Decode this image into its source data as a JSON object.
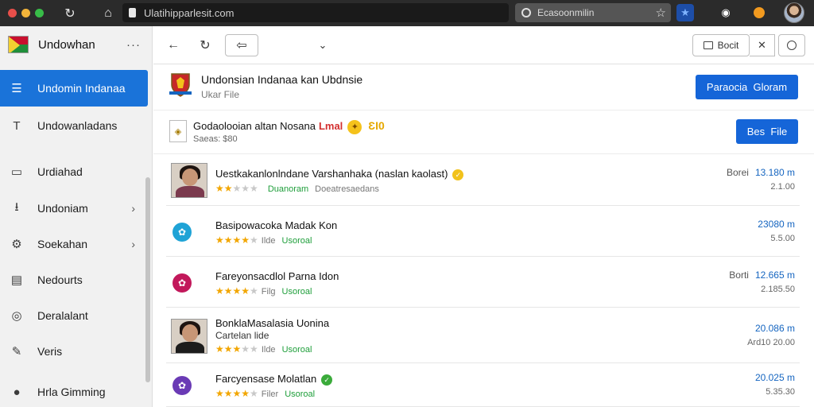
{
  "browser": {
    "url": "Ulatihipparlesit.com",
    "search": "Ecasoonmilin",
    "traffic_lights": [
      "#e84f4a",
      "#f3b43a",
      "#38bc48"
    ],
    "extensions": [
      {
        "icon": "star-outline-icon",
        "color": "#dddddd"
      },
      {
        "icon": "star-extension-icon",
        "color": "#1a73e8"
      },
      {
        "icon": "camera-extension-icon",
        "color": "#333333"
      },
      {
        "icon": "orange-extension-icon",
        "color": "#f29a1f"
      }
    ]
  },
  "sidebar": {
    "title": "Undowhan",
    "more": "···",
    "items": [
      {
        "label": "Undomin Indanaa",
        "icon": "list-icon",
        "active": true
      },
      {
        "label": "Undowanladans",
        "icon": "text-icon"
      },
      {
        "label": "Urdiahad",
        "icon": "drive-icon"
      },
      {
        "label": "Undoniam",
        "icon": "upload-icon",
        "chevron": true
      },
      {
        "label": "Soekahan",
        "icon": "gear-icon",
        "chevron": true
      },
      {
        "label": "Nedourts",
        "icon": "document-icon"
      },
      {
        "label": "Deralalant",
        "icon": "circle-icon"
      },
      {
        "label": "Veris",
        "icon": "pen-icon"
      },
      {
        "label": "Hrla Gimming",
        "icon": "chat-icon"
      }
    ]
  },
  "toolbar": {
    "back": "←",
    "reload": "↻",
    "forward": "⇦",
    "dropdown": "⌄",
    "action_label": "Bocit",
    "close": "✕",
    "search": "🔍"
  },
  "header": {
    "title": "Undonsian Indanaa kan Ubdnsie",
    "subtitle": "Ukar File",
    "button": "Paraocia  Gloram"
  },
  "featured": {
    "title": "Godaolooian altan Nosana",
    "tag": "Lmal",
    "badge": "ƐI0",
    "subtitle": "Saeas: $80",
    "button": "Bes  File"
  },
  "rows": [
    {
      "title": "Uestkakanlonlndane Varshanhaka (naslan kaolast)",
      "rating": 2,
      "meta_grey": "",
      "meta_green": "Duanoram",
      "meta_extra": "Doeatresaedans",
      "prefix": "Borei",
      "price": "13.180 m",
      "sub": "2.1.00",
      "kind": "photo",
      "body_color": "#7b3a4e",
      "check_color": "#f2c21b"
    },
    {
      "title": "Basipowacoka Madak Kon",
      "rating": 4,
      "meta_grey": "Ilde",
      "meta_green": "Usoroal",
      "prefix": "",
      "price": "23080 m",
      "sub": "5.5.00",
      "kind": "icon",
      "icon_color": "#1fa3d6"
    },
    {
      "title": "Fareyonsacdlol Parna Idon",
      "rating": 4,
      "meta_grey": "Filg",
      "meta_green": "Usoroal",
      "prefix": "Borti",
      "price": "12.665 m",
      "sub": "2.185.50",
      "kind": "icon",
      "icon_color": "#c2185b"
    },
    {
      "title": "BonklaMasalasia Uonina",
      "subtitle": "Cartelan lide",
      "rating": 3,
      "meta_grey": "Ilde",
      "meta_green": "Usoroal",
      "prefix": "",
      "price": "20.086 m",
      "sub": "Ard10 20.00",
      "kind": "photo",
      "body_color": "#1c1c1c",
      "check_color": ""
    },
    {
      "title": "Farcyensase Molatlan",
      "rating": 4,
      "meta_grey": "Filer",
      "meta_green": "Usoroal",
      "prefix": "",
      "price": "20.025 m",
      "sub": "5.35.30",
      "kind": "icon",
      "icon_color": "#6a3ab5",
      "check_color": "#3bab3b"
    }
  ]
}
